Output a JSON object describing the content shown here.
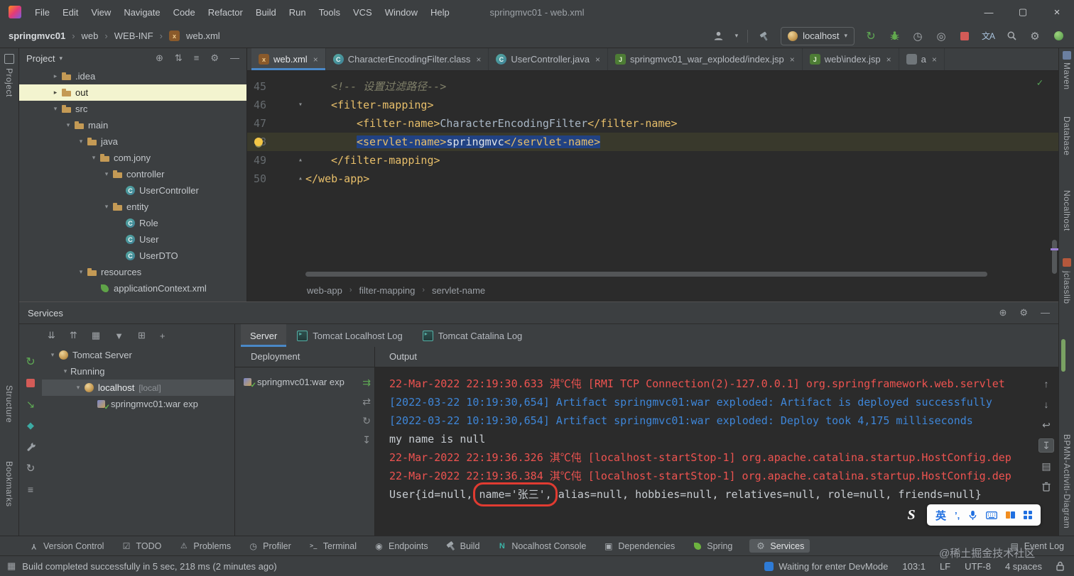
{
  "titlebar": {
    "menus": [
      "File",
      "Edit",
      "View",
      "Navigate",
      "Code",
      "Refactor",
      "Build",
      "Run",
      "Tools",
      "VCS",
      "Window",
      "Help"
    ],
    "title": "springmvc01 - web.xml"
  },
  "toolbar": {
    "project_crumb": "springmvc01",
    "crumbs": [
      "web",
      "WEB-INF"
    ],
    "file_crumb": "web.xml",
    "run_config": "localhost"
  },
  "stripes": {
    "left_top": "Project",
    "left_bottom": [
      "Structure",
      "Bookmarks"
    ],
    "right": [
      "Maven",
      "Database",
      "Nocalhost",
      "jclasslib",
      "BPMN-Activiti-Diagram"
    ]
  },
  "project": {
    "header": "Project",
    "tree": [
      {
        "arrow": "▸",
        "icon": "folder",
        "label": ".idea",
        "indent": 1
      },
      {
        "arrow": "▸",
        "icon": "folder",
        "label": "out",
        "indent": 1,
        "cls": "hl"
      },
      {
        "arrow": "▾",
        "icon": "folder",
        "label": "src",
        "indent": 1
      },
      {
        "arrow": "▾",
        "icon": "folder",
        "label": "main",
        "indent": 2
      },
      {
        "arrow": "▾",
        "icon": "folder",
        "label": "java",
        "indent": 3
      },
      {
        "arrow": "▾",
        "icon": "folder",
        "label": "com.jony",
        "indent": 4
      },
      {
        "arrow": "▾",
        "icon": "folder",
        "label": "controller",
        "indent": 5
      },
      {
        "icon": "class",
        "label": "UserController",
        "indent": 6
      },
      {
        "arrow": "▾",
        "icon": "folder",
        "label": "entity",
        "indent": 5
      },
      {
        "icon": "class",
        "label": "Role",
        "indent": 6
      },
      {
        "icon": "class",
        "label": "User",
        "indent": 6
      },
      {
        "icon": "class",
        "label": "UserDTO",
        "indent": 6
      },
      {
        "arrow": "▾",
        "icon": "folder",
        "label": "resources",
        "indent": 3
      },
      {
        "icon": "spring",
        "label": "applicationContext.xml",
        "indent": 4
      }
    ]
  },
  "editor": {
    "tabs": [
      {
        "icon": "xml",
        "label": "web.xml",
        "cls": "sel"
      },
      {
        "icon": "class",
        "label": "CharacterEncodingFilter.class"
      },
      {
        "icon": "class",
        "label": "UserController.java"
      },
      {
        "icon": "jsp",
        "label": "springmvc01_war_exploded/index.jsp"
      },
      {
        "icon": "jsp",
        "label": "web\\index.jsp"
      },
      {
        "icon": "file",
        "label": "a"
      }
    ],
    "code": {
      "l45": {
        "num": "45",
        "comment": "<!-- 设置过滤路径-->"
      },
      "l46": {
        "num": "46",
        "tag": "<filter-mapping>"
      },
      "l47": {
        "num": "47",
        "open": "<filter-name>",
        "text": "CharacterEncodingFilter",
        "close": "</filter-name>"
      },
      "l48": {
        "num": "48",
        "open": "<servlet-name>",
        "text": "springmvc",
        "close": "</servlet-name>"
      },
      "l49": {
        "num": "49",
        "tag": "</filter-mapping>"
      },
      "l50": {
        "num": "50",
        "tag": "</web-app>"
      }
    },
    "breadcrumbs": [
      "web-app",
      "filter-mapping",
      "servlet-name"
    ]
  },
  "services": {
    "title": "Services",
    "tree": [
      {
        "arrow": "▾",
        "icon": "tomcat",
        "label": "Tomcat Server",
        "indent": 0
      },
      {
        "arrow": "▾",
        "icon": "none",
        "label": "Running",
        "indent": 1
      },
      {
        "arrow": "▾",
        "icon": "tomcat",
        "label": "localhost",
        "extra": "[local]",
        "indent": 2,
        "cls": "sel"
      },
      {
        "icon": "artifact",
        "label": "springmvc01:war exp",
        "indent": 3
      }
    ],
    "tabs": [
      {
        "label": "Server",
        "cls": "sel"
      },
      {
        "label": "Tomcat Localhost Log",
        "icon": "console"
      },
      {
        "label": "Tomcat Catalina Log",
        "icon": "console"
      }
    ],
    "deployment_header": "Deployment",
    "deployment_item": "springmvc01:war exp",
    "output_header": "Output",
    "console": [
      {
        "text": "22-Mar-2022 22:19:30.633 淇℃伅 [RMI TCP Connection(2)-127.0.0.1] org.springframework.web.servlet",
        "cls": "red"
      },
      {
        "text": "[2022-03-22 10:19:30,654] Artifact springmvc01:war exploded: Artifact is deployed successfully",
        "cls": "blue"
      },
      {
        "text": "[2022-03-22 10:19:30,654] Artifact springmvc01:war exploded: Deploy took 4,175 milliseconds",
        "cls": "blue"
      },
      {
        "text": "my name is null",
        "cls": "plain"
      },
      {
        "text": "22-Mar-2022 22:19:36.326 淇℃伅 [localhost-startStop-1] org.apache.catalina.startup.HostConfig.dep",
        "cls": "red"
      },
      {
        "text": "22-Mar-2022 22:19:36.384 淇℃伅 [localhost-startStop-1] org.apache.catalina.startup.HostConfig.dep",
        "cls": "red"
      }
    ],
    "user_line": {
      "prefix": "User{id=null, ",
      "boxed": "name='张三',",
      "suffix": " alias=null, hobbies=null, relatives=null, role=null, friends=null}"
    }
  },
  "bottom_bar": {
    "items": [
      {
        "icon": "branch",
        "label": "Version Control"
      },
      {
        "icon": "todo",
        "label": "TODO"
      },
      {
        "icon": "problems",
        "label": "Problems"
      },
      {
        "icon": "profiler",
        "label": "Profiler"
      },
      {
        "icon": "terminal",
        "label": "Terminal"
      },
      {
        "icon": "endpoints",
        "label": "Endpoints"
      },
      {
        "icon": "build",
        "label": "Build"
      },
      {
        "icon": "nocalhost",
        "label": "Nocalhost Console"
      },
      {
        "icon": "dependencies",
        "label": "Dependencies"
      },
      {
        "icon": "spring",
        "label": "Spring"
      },
      {
        "icon": "services",
        "label": "Services",
        "cls": "sel"
      },
      {
        "icon": "eventlog",
        "label": "Event Log"
      }
    ]
  },
  "status_bar": {
    "message": "Build completed successfully in 5 sec, 218 ms (2 minutes ago)",
    "devmode": "Waiting for enter DevMode",
    "caret": "103:1",
    "line_ending": "LF",
    "encoding": "UTF-8",
    "indent": "4 spaces"
  },
  "ime": {
    "lang": "英",
    "punct": "’,"
  },
  "watermark": "@稀土掘金技术社区"
}
